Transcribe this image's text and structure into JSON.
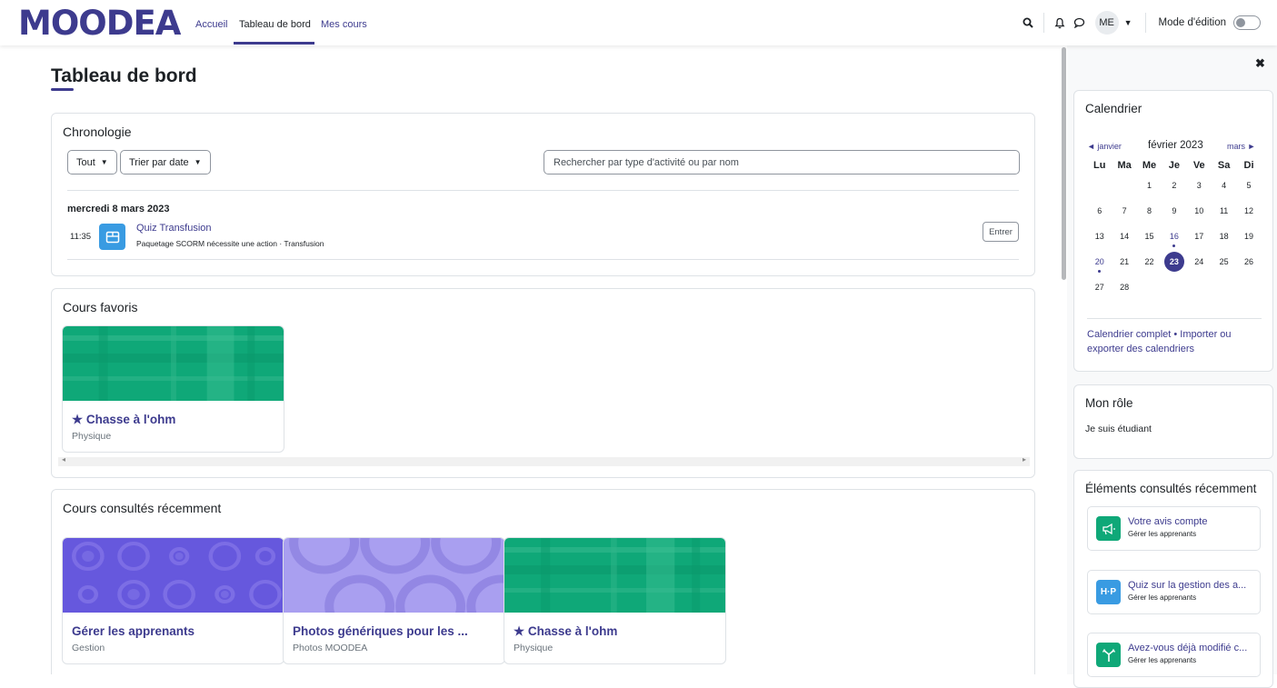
{
  "app": {
    "logo": "MOODEA",
    "nav": [
      "Accueil",
      "Tableau de bord",
      "Mes cours"
    ],
    "avatar_initials": "ME",
    "edit_mode_label": "Mode d'édition"
  },
  "page": {
    "title": "Tableau de bord"
  },
  "timeline": {
    "title": "Chronologie",
    "filter_label": "Tout",
    "sort_label": "Trier par date",
    "search_placeholder": "Rechercher par type d'activité ou par nom",
    "date": "mercredi 8 mars 2023",
    "event": {
      "time": "11:35",
      "name": "Quiz Transfusion",
      "subtitle": "Paquetage SCORM nécessite une action · Transfusion",
      "action": "Entrer"
    }
  },
  "starred": {
    "title": "Cours favoris",
    "courses": [
      {
        "name": "★ Chasse à l'ohm",
        "category": "Physique"
      }
    ]
  },
  "recent_courses": {
    "title": "Cours consultés récemment",
    "courses": [
      {
        "name": "Gérer les apprenants",
        "category": "Gestion"
      },
      {
        "name": "Photos génériques pour les ...",
        "category": "Photos MOODEA"
      },
      {
        "name": "★ Chasse à l'ohm",
        "category": "Physique"
      }
    ]
  },
  "calendar": {
    "title": "Calendrier",
    "prev": "◄ janvier",
    "month": "février 2023",
    "next": "mars ►",
    "weekdays": [
      "Lu",
      "Ma",
      "Me",
      "Je",
      "Ve",
      "Sa",
      "Di"
    ],
    "weeks": [
      [
        "",
        "",
        "1",
        "2",
        "3",
        "4",
        "5"
      ],
      [
        "6",
        "7",
        "8",
        "9",
        "10",
        "11",
        "12"
      ],
      [
        "13",
        "14",
        "15",
        "16",
        "17",
        "18",
        "19"
      ],
      [
        "20",
        "21",
        "22",
        "23",
        "24",
        "25",
        "26"
      ],
      [
        "27",
        "28",
        "",
        "",
        "",
        "",
        ""
      ]
    ],
    "event_days": [
      "16",
      "20"
    ],
    "today": "23",
    "footer_links": "Calendrier complet • Importer ou exporter des calendriers"
  },
  "role": {
    "title": "Mon rôle",
    "text": "Je suis étudiant"
  },
  "recent_items": {
    "title": "Éléments consultés récemment",
    "items": [
      {
        "name": "Votre avis compte",
        "course": "Gérer les apprenants",
        "icon": "megaphone-icon",
        "color": "#0fa878"
      },
      {
        "name": "Quiz sur la gestion des a...",
        "course": "Gérer les apprenants",
        "icon": "h5p-icon",
        "color": "#399be2"
      },
      {
        "name": "Avez-vous déjà modifié c...",
        "course": "Gérer les apprenants",
        "icon": "choice-icon",
        "color": "#0fa878"
      }
    ]
  },
  "colors": {
    "brand": "#3d3b8e",
    "green": "#0fa878",
    "blue": "#399be2"
  }
}
